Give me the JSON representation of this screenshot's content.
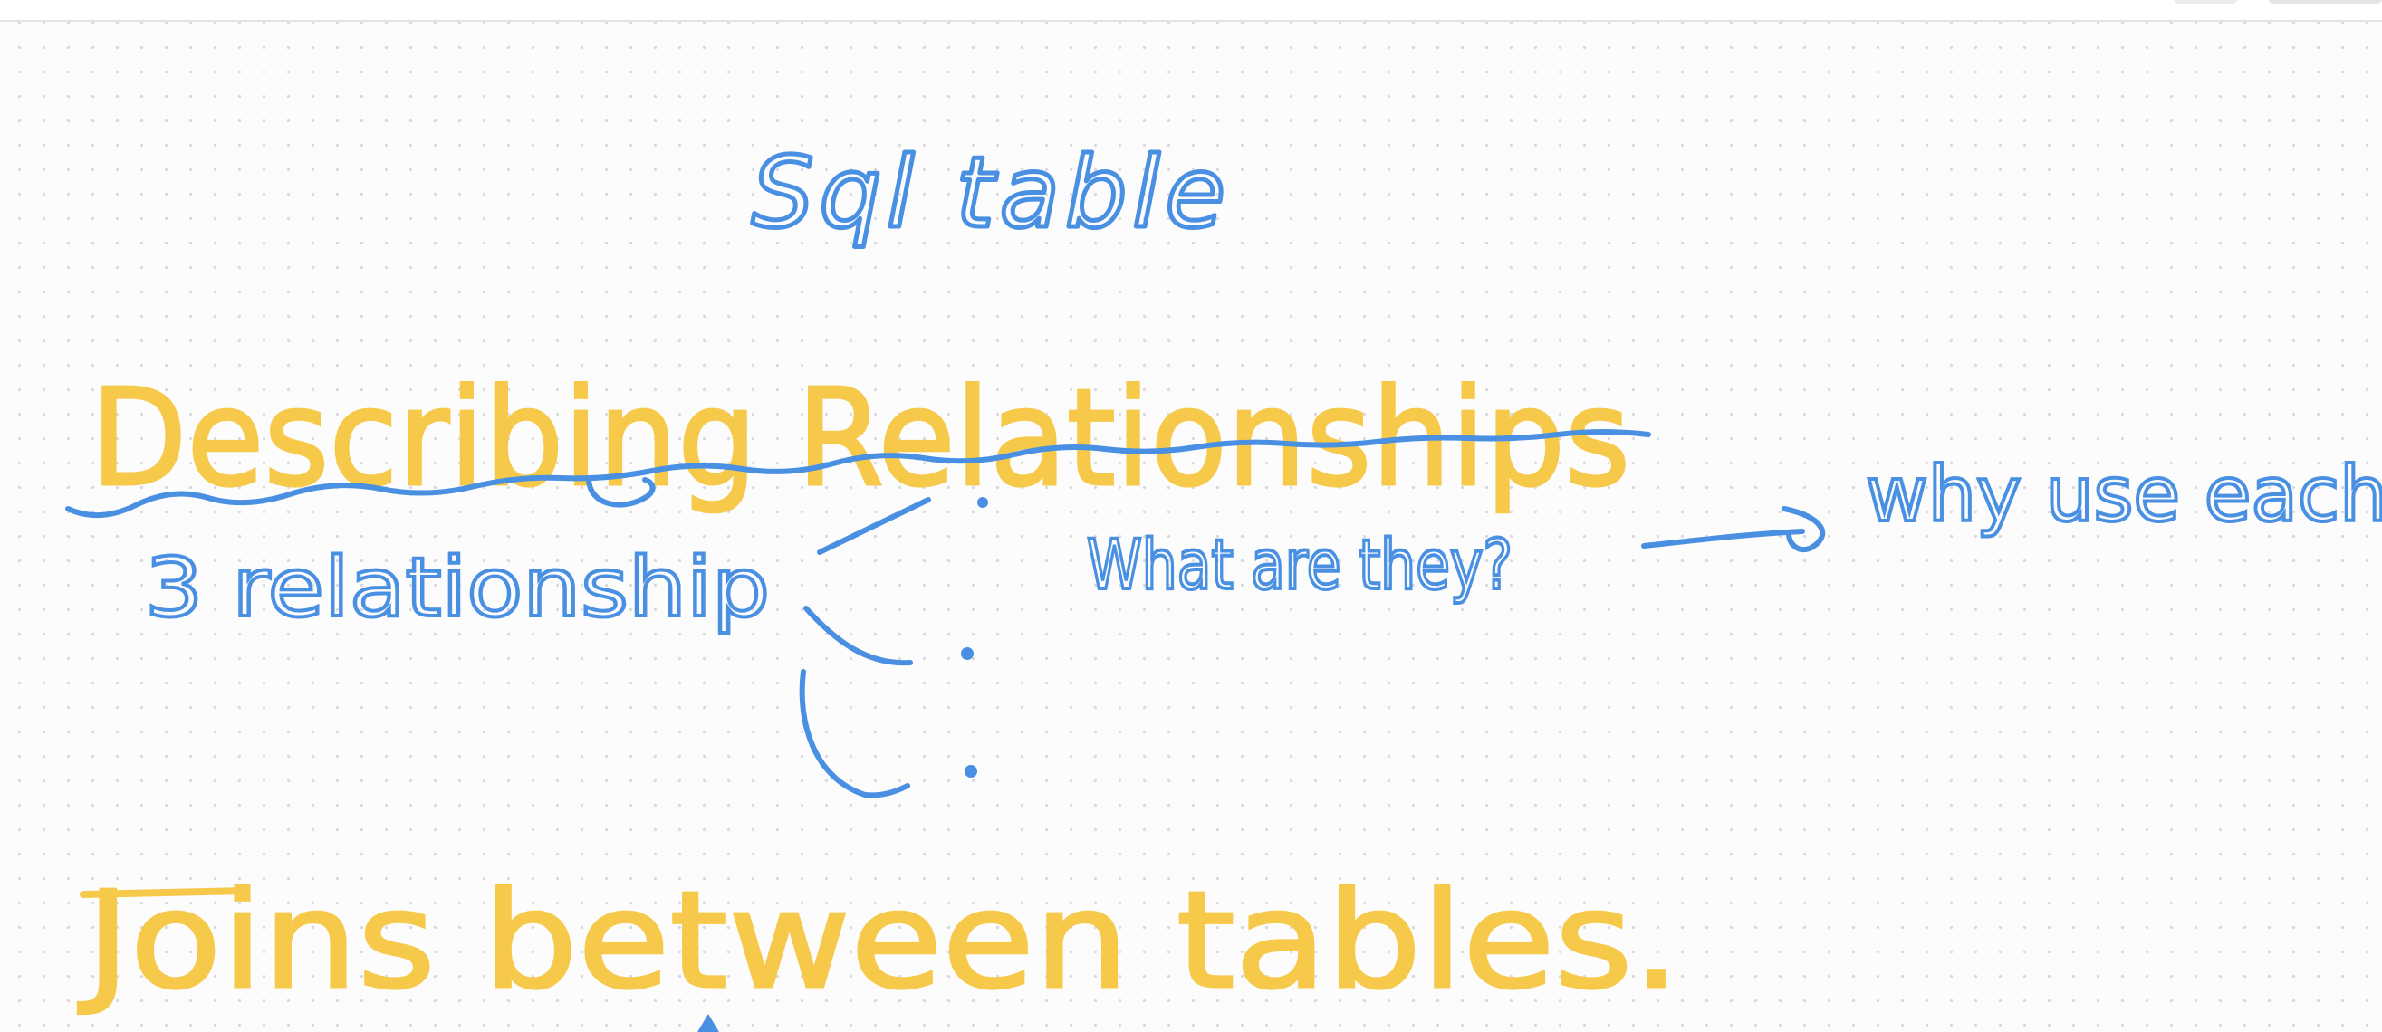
{
  "colors": {
    "blue_ink": "#4a90e2",
    "yellow_ink": "#f6c94a",
    "background": "#fcfcfc",
    "grid_dot": "#d9d9de"
  },
  "notes": {
    "sql_table": "Sql table",
    "heading_relationships": "Describing Relationships",
    "three_relationships": "3 relationship",
    "what_are_they": "What are they?",
    "why_use": "why use each of them.",
    "heading_joins": "Joins between tables."
  }
}
